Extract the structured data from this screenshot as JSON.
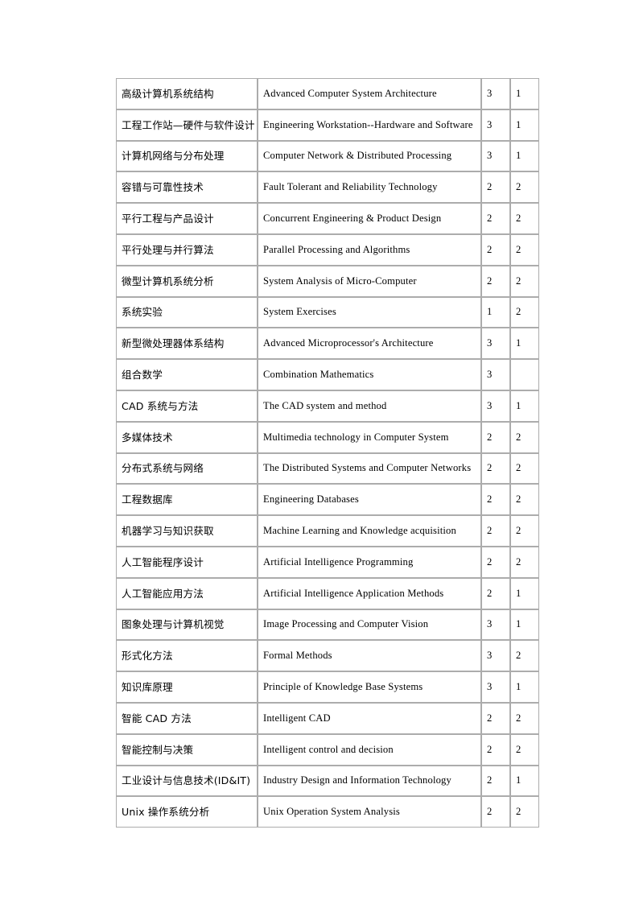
{
  "document": {
    "type": "course-listing-table",
    "background_color": "#ffffff",
    "border_color": "#acacac",
    "text_color": "#000000"
  },
  "table": {
    "columns": [
      {
        "key": "name_cn",
        "name": "chinese-course-name",
        "header": ""
      },
      {
        "key": "name_en",
        "name": "english-course-name",
        "header": ""
      },
      {
        "key": "credits",
        "name": "credits",
        "header": ""
      },
      {
        "key": "term",
        "name": "term",
        "header": ""
      }
    ],
    "rows": [
      {
        "name_cn": "高级计算机系统结构",
        "name_en": "Advanced Computer System Architecture",
        "credits": "3",
        "term": "1"
      },
      {
        "name_cn": "工程工作站—硬件与软件设计",
        "name_en": "Engineering  Workstation--Hardware and Software",
        "credits": "3",
        "term": "1"
      },
      {
        "name_cn": "计算机网络与分布处理",
        "name_en": "Computer Network & Distributed Processing",
        "credits": "3",
        "term": "1"
      },
      {
        "name_cn": "容错与可靠性技术",
        "name_en": "Fault Tolerant and Reliability Technology",
        "credits": "2",
        "term": "2"
      },
      {
        "name_cn": "平行工程与产品设计",
        "name_en": "Concurrent Engineering  & Product Design",
        "credits": "2",
        "term": "2"
      },
      {
        "name_cn": "平行处理与并行算法",
        "name_en": "Parallel Processing and Algorithms",
        "credits": "2",
        "term": "2"
      },
      {
        "name_cn": "微型计算机系统分析",
        "name_en": "System Analysis of Micro-Computer",
        "credits": "2",
        "term": "2"
      },
      {
        "name_cn": "系统实验",
        "name_en": "System Exercises",
        "credits": "1",
        "term": "2"
      },
      {
        "name_cn": "新型微处理器体系结构",
        "name_en": "Advanced Microprocessor's Architecture",
        "credits": "3",
        "term": "1"
      },
      {
        "name_cn": "组合数学",
        "name_en": "Combination  Mathematics",
        "credits": "3",
        "term": ""
      },
      {
        "name_cn": "CAD 系统与方法",
        "name_en": "The CAD system and method",
        "credits": "3",
        "term": "1"
      },
      {
        "name_cn": "多媒体技术",
        "name_en": "Multimedia  technology in Computer System",
        "credits": "2",
        "term": "2"
      },
      {
        "name_cn": "分布式系统与网络",
        "name_en": "The Distributed Systems and Computer Networks",
        "credits": "2",
        "term": "2"
      },
      {
        "name_cn": "工程数据库",
        "name_en": "Engineering  Databases",
        "credits": "2",
        "term": "2"
      },
      {
        "name_cn": "机器学习与知识获取",
        "name_en": "Machine Learning and Knowledge acquisition",
        "credits": "2",
        "term": "2"
      },
      {
        "name_cn": "人工智能程序设计",
        "name_en": "Artificial  Intelligence  Programming",
        "credits": "2",
        "term": "2"
      },
      {
        "name_cn": "人工智能应用方法",
        "name_en": "Artificial  Intelligence  Application Methods",
        "credits": "2",
        "term": "1"
      },
      {
        "name_cn": "图象处理与计算机视觉",
        "name_en": "Image Processing and Computer Vision",
        "credits": "3",
        "term": "1"
      },
      {
        "name_cn": "形式化方法",
        "name_en": "Formal Methods",
        "credits": "3",
        "term": "2"
      },
      {
        "name_cn": "知识库原理",
        "name_en": "Principle of Knowledge  Base Systems",
        "credits": "3",
        "term": "1"
      },
      {
        "name_cn": "智能 CAD 方法",
        "name_en": "Intelligent CAD",
        "credits": "2",
        "term": "2"
      },
      {
        "name_cn": "智能控制与决策",
        "name_en": "Intelligent control and decision",
        "credits": "2",
        "term": "2"
      },
      {
        "name_cn": "工业设计与信息技术(ID&IT)",
        "name_en": "Industry Design and Information  Technology",
        "credits": "2",
        "term": "1"
      },
      {
        "name_cn": "Unix 操作系统分析",
        "name_en": "Unix Operation System Analysis",
        "credits": "2",
        "term": "2"
      }
    ]
  }
}
